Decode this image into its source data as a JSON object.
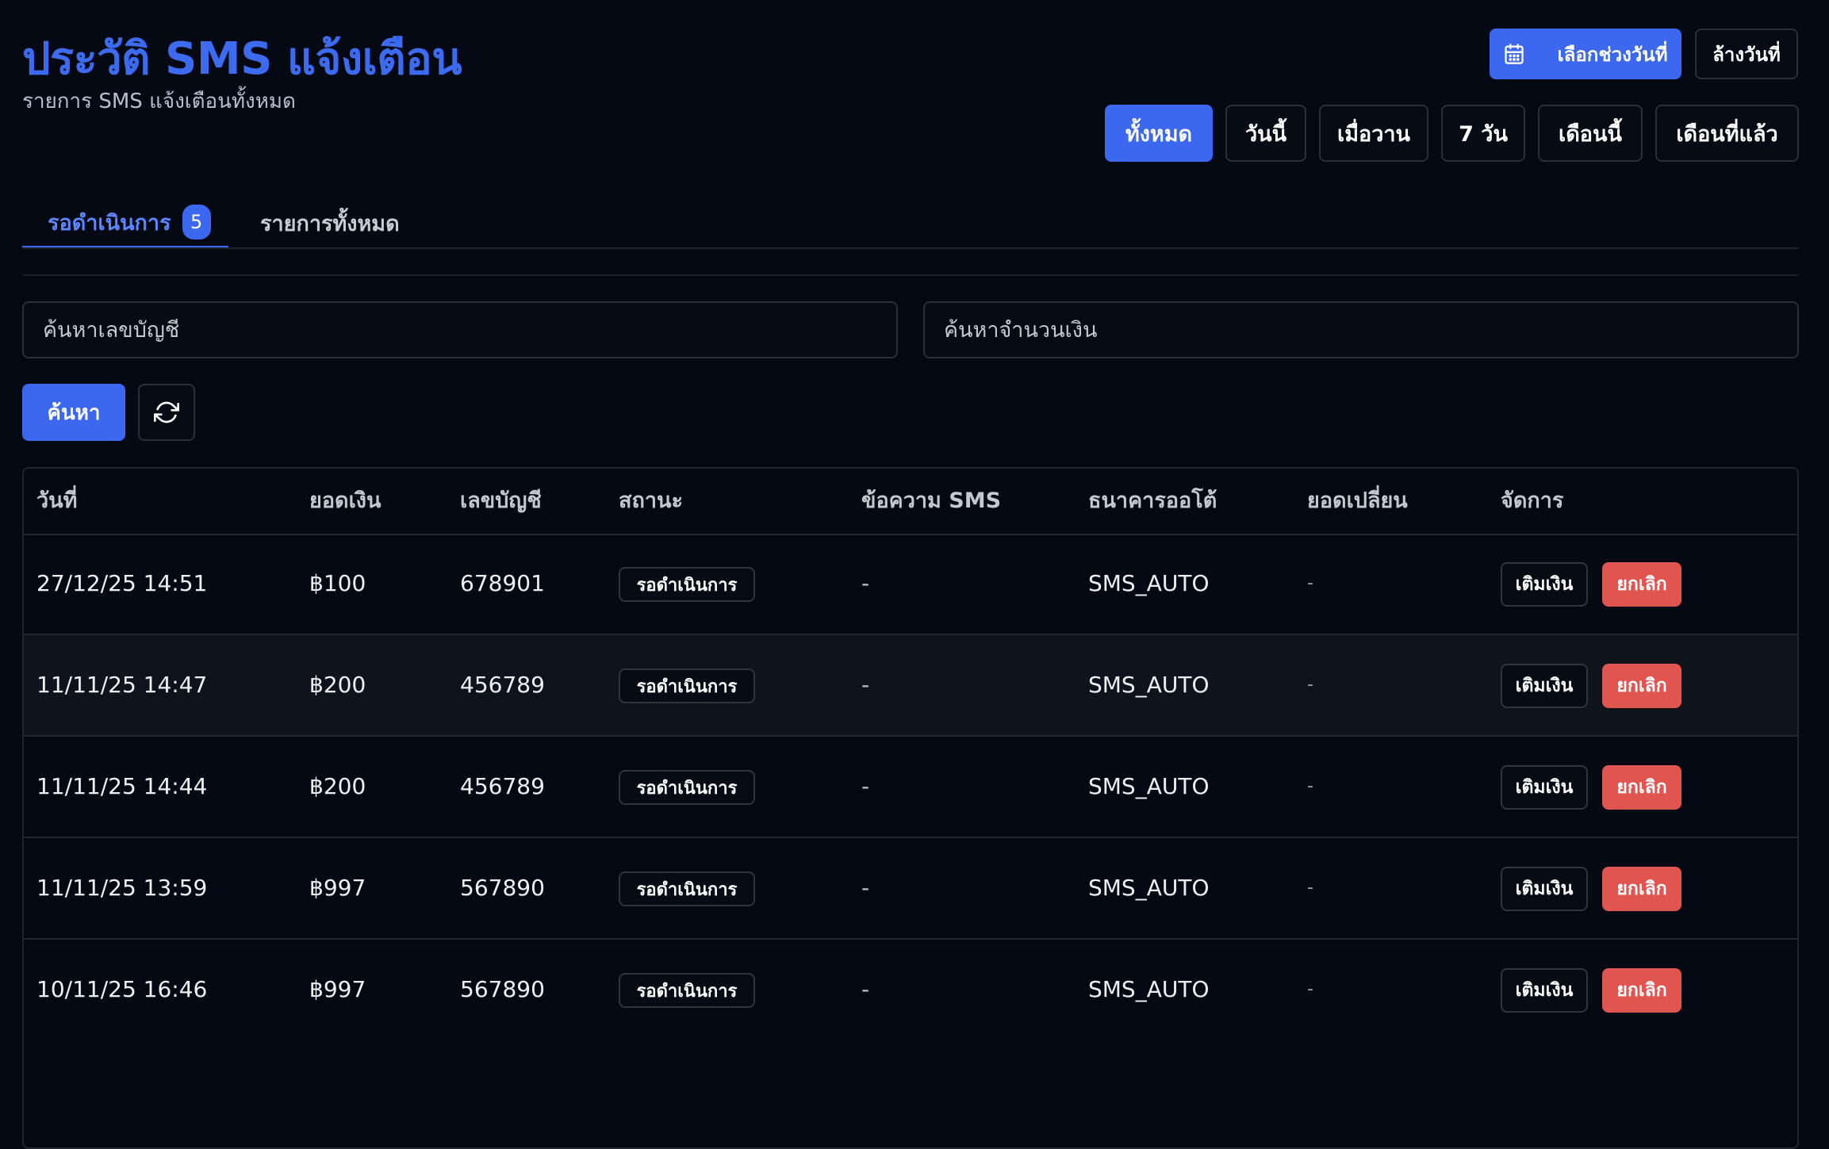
{
  "header": {
    "title": "ประวัติ SMS แจ้งเตือน",
    "subtitle": "รายการ SMS แจ้งเตือนทั้งหมด"
  },
  "date_controls": {
    "range_label": "เลือกช่วงวันที่",
    "clear_label": "ล้างวันที่",
    "quick_filters": [
      {
        "label": "ทั้งหมด",
        "active": true
      },
      {
        "label": "วันนี้",
        "active": false
      },
      {
        "label": "เมื่อวาน",
        "active": false
      },
      {
        "label": "7 วัน",
        "active": false
      },
      {
        "label": "เดือนนี้",
        "active": false
      },
      {
        "label": "เดือนที่แล้ว",
        "active": false
      }
    ]
  },
  "tabs": [
    {
      "label": "รอดำเนินการ",
      "badge": "5",
      "active": true
    },
    {
      "label": "รายการทั้งหมด",
      "active": false
    }
  ],
  "search": {
    "account_placeholder": "ค้นหาเลขบัญชี",
    "amount_placeholder": "ค้นหาจำนวนเงิน",
    "search_label": "ค้นหา"
  },
  "table": {
    "columns": [
      "วันที่",
      "ยอดเงิน",
      "เลขบัญชี",
      "สถานะ",
      "ข้อความ SMS",
      "ธนาคารออโต้",
      "ยอดเปลี่ยน",
      "จัดการ"
    ],
    "rows": [
      {
        "date": "27/12/25 14:51",
        "amount": "฿100",
        "account": "678901",
        "status": "รอดำเนินการ",
        "sms": "-",
        "bank": "SMS_AUTO",
        "change": "-"
      },
      {
        "date": "11/11/25 14:47",
        "amount": "฿200",
        "account": "456789",
        "status": "รอดำเนินการ",
        "sms": "-",
        "bank": "SMS_AUTO",
        "change": "-"
      },
      {
        "date": "11/11/25 14:44",
        "amount": "฿200",
        "account": "456789",
        "status": "รอดำเนินการ",
        "sms": "-",
        "bank": "SMS_AUTO",
        "change": "-"
      },
      {
        "date": "11/11/25 13:59",
        "amount": "฿997",
        "account": "567890",
        "status": "รอดำเนินการ",
        "sms": "-",
        "bank": "SMS_AUTO",
        "change": "-"
      },
      {
        "date": "10/11/25 16:46",
        "amount": "฿997",
        "account": "567890",
        "status": "รอดำเนินการ",
        "sms": "-",
        "bank": "SMS_AUTO",
        "change": "-"
      }
    ],
    "actions": {
      "topup_label": "เติมเงิน",
      "cancel_label": "ยกเลิก"
    }
  },
  "colors": {
    "background": "#050913",
    "accent": "#3c68ef",
    "danger": "#e05550",
    "border": "#2a2f3b"
  },
  "icons": {
    "range": "calendar-icon",
    "refresh": "refresh-icon"
  }
}
